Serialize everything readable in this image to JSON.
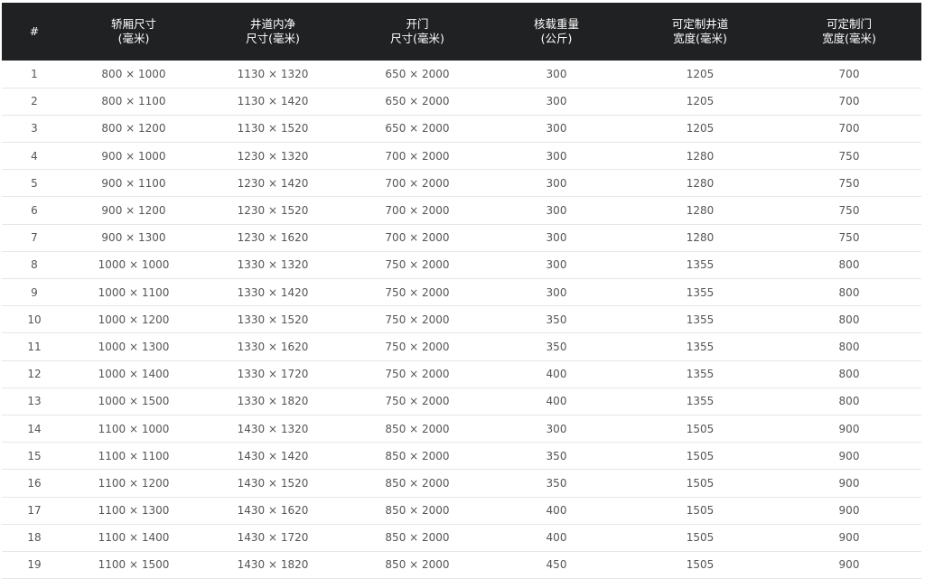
{
  "table": {
    "headers": [
      {
        "line1": "#",
        "line2": ""
      },
      {
        "line1": "轿厢尺寸",
        "line2": "(毫米)"
      },
      {
        "line1": "井道内净",
        "line2": "尺寸(毫米)"
      },
      {
        "line1": "开门",
        "line2": "尺寸(毫米)"
      },
      {
        "line1": "核载重量",
        "line2": "(公斤)"
      },
      {
        "line1": "可定制井道",
        "line2": "宽度(毫米)"
      },
      {
        "line1": "可定制门",
        "line2": "宽度(毫米)"
      }
    ],
    "rows": [
      [
        "1",
        "800 × 1000",
        "1130 × 1320",
        "650 × 2000",
        "300",
        "1205",
        "700"
      ],
      [
        "2",
        "800 × 1100",
        "1130 × 1420",
        "650 × 2000",
        "300",
        "1205",
        "700"
      ],
      [
        "3",
        "800 × 1200",
        "1130 × 1520",
        "650 × 2000",
        "300",
        "1205",
        "700"
      ],
      [
        "4",
        "900 × 1000",
        "1230 × 1320",
        "700 × 2000",
        "300",
        "1280",
        "750"
      ],
      [
        "5",
        "900 × 1100",
        "1230 × 1420",
        "700 × 2000",
        "300",
        "1280",
        "750"
      ],
      [
        "6",
        "900 × 1200",
        "1230 × 1520",
        "700 × 2000",
        "300",
        "1280",
        "750"
      ],
      [
        "7",
        "900 × 1300",
        "1230 × 1620",
        "700 × 2000",
        "300",
        "1280",
        "750"
      ],
      [
        "8",
        "1000 × 1000",
        "1330 × 1320",
        "750 × 2000",
        "300",
        "1355",
        "800"
      ],
      [
        "9",
        "1000 × 1100",
        "1330 × 1420",
        "750 × 2000",
        "300",
        "1355",
        "800"
      ],
      [
        "10",
        "1000 × 1200",
        "1330 × 1520",
        "750 × 2000",
        "350",
        "1355",
        "800"
      ],
      [
        "11",
        "1000 × 1300",
        "1330 × 1620",
        "750 × 2000",
        "350",
        "1355",
        "800"
      ],
      [
        "12",
        "1000 × 1400",
        "1330 × 1720",
        "750 × 2000",
        "400",
        "1355",
        "800"
      ],
      [
        "13",
        "1000 × 1500",
        "1330 × 1820",
        "750 × 2000",
        "400",
        "1355",
        "800"
      ],
      [
        "14",
        "1100 × 1000",
        "1430 × 1320",
        "850 × 2000",
        "300",
        "1505",
        "900"
      ],
      [
        "15",
        "1100 × 1100",
        "1430 × 1420",
        "850 × 2000",
        "350",
        "1505",
        "900"
      ],
      [
        "16",
        "1100 × 1200",
        "1430 × 1520",
        "850 × 2000",
        "350",
        "1505",
        "900"
      ],
      [
        "17",
        "1100 × 1300",
        "1430 × 1620",
        "850 × 2000",
        "400",
        "1505",
        "900"
      ],
      [
        "18",
        "1100 × 1400",
        "1430 × 1720",
        "850 × 2000",
        "400",
        "1505",
        "900"
      ],
      [
        "19",
        "1100 × 1500",
        "1430 × 1820",
        "850 × 2000",
        "450",
        "1505",
        "900"
      ]
    ]
  },
  "colors": {
    "header_bg": "#202123",
    "header_text": "#ffffff",
    "cell_text": "#555555",
    "row_border": "#e6e6e6"
  }
}
